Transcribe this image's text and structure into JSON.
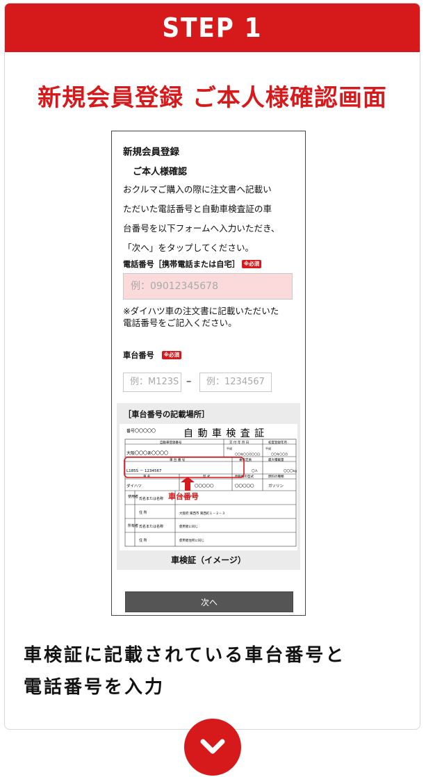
{
  "step": {
    "label": "STEP 1"
  },
  "title": "新規会員登録 ご本人様確認画面",
  "phone": {
    "page_title": "新規会員登録",
    "subtitle": "ご本人様確認",
    "description": [
      "おクルマご購入の際に注文書へ記載い",
      "ただいた電話番号と自動車検査証の車",
      "台番号を以下フォームへ入力いただき、",
      "「次へ」をタップしてください。"
    ],
    "tel_label": "電話番号［携帯電話または自宅］",
    "required_badge": "※必須",
    "tel_placeholder": "例：09012345678",
    "tel_note": [
      "※ダイハツ車の注文書に記載いただいた",
      "電話番号をご記入ください。"
    ],
    "chassis_label": "車台番号",
    "chassis_placeholder_1": "例：M123S",
    "chassis_dash": "–",
    "chassis_placeholder_2": "例：1234567",
    "location_title": "［車台番号の記載場所］",
    "certificate": {
      "number_label": "番号〇〇〇〇〇",
      "heading": "自 動 車 検 査 証",
      "col_regno": "自動車登録番号",
      "col_date": "交 付 年 月 日",
      "col_first": "初度登録年月",
      "reg_value": "大阪〇〇〇あ〇〇〇〇",
      "era_1": "平成",
      "era_2": "平成",
      "date_value": "〇〇年〇〇月〇〇日",
      "first_value": "〇〇年〇〇月",
      "chassis_header": "車 台 番 号",
      "capacity_header": "乗車定員",
      "max_load_header": "最大積載量",
      "chassis_value": "L185S － 1234567",
      "capacity_value": "〇人",
      "max_load_value": "〇〇〇kg",
      "name_header": "車 名",
      "type_header": "型 式",
      "engine_header": "原動機の型式",
      "fuel_header": "燃料の種類",
      "maker_value": "ダイハツ",
      "type_value": "〇〇〇〇〇",
      "engine_value": "〇〇〇〇〇",
      "fuel_value": "ガソリン",
      "user_label": "使用者",
      "owner_label": "所有者",
      "name_field": "氏名または名称",
      "address_field": "住 所",
      "user_name": "ダイハツ太郎",
      "user_address": "大阪府 東西市 東西町１－２－３",
      "owner_name": "使用者に同じ",
      "owner_address": "使用者住所に同じ",
      "callout": "車台番号"
    },
    "certificate_caption": "車検証（イメージ）",
    "next_button": "次へ"
  },
  "instruction": [
    "車検証に記載されている車台番号と",
    "電話番号を入力"
  ],
  "colors": {
    "brand_red": "#d6191b",
    "input_pink": "#fadada",
    "button_gray": "#555555"
  },
  "icons": {
    "scroll_down": "chevron-down-icon"
  }
}
